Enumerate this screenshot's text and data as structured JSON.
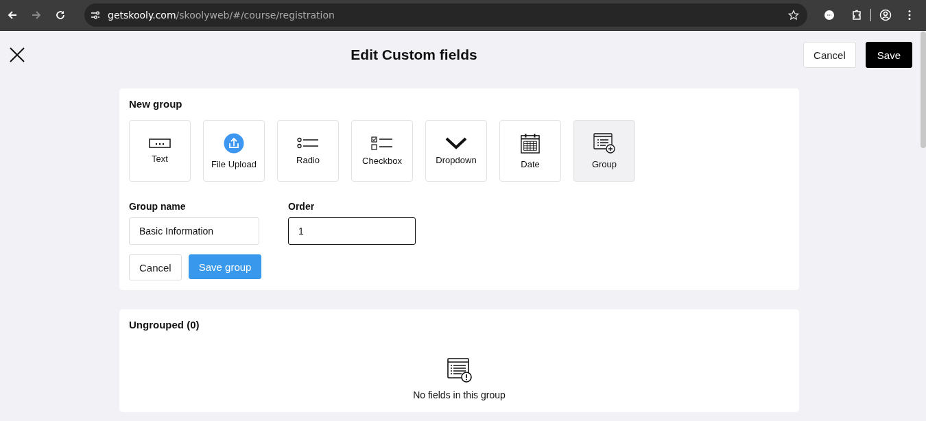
{
  "browser": {
    "url_host": "getskooly.com",
    "url_path": "/skoolyweb/#/course/registration"
  },
  "header": {
    "title": "Edit Custom fields",
    "buttons": [
      {
        "label": "Cancel",
        "kind": "secondary"
      },
      {
        "label": "Save",
        "kind": "primary"
      }
    ]
  },
  "new_group": {
    "title": "New group",
    "field_types": [
      {
        "label": "Text",
        "kind": "text",
        "selected": false
      },
      {
        "label": "File Upload",
        "kind": "upload",
        "selected": false
      },
      {
        "label": "Radio",
        "kind": "radio",
        "selected": false
      },
      {
        "label": "Checkbox",
        "kind": "checkbox",
        "selected": false
      },
      {
        "label": "Dropdown",
        "kind": "dropdown",
        "selected": false
      },
      {
        "label": "Date",
        "kind": "date",
        "selected": false
      },
      {
        "label": "Group",
        "kind": "group",
        "selected": true
      }
    ],
    "fields": [
      {
        "label": "Group name",
        "value": "Basic Information",
        "focused": false
      },
      {
        "label": "Order",
        "value": "1",
        "focused": true
      }
    ],
    "buttons": [
      {
        "label": "Cancel",
        "kind": "secondary"
      },
      {
        "label": "Save group",
        "kind": "primary"
      }
    ]
  },
  "ungrouped": {
    "title": "Ungrouped (0)",
    "empty_message": "No fields in this group"
  }
}
